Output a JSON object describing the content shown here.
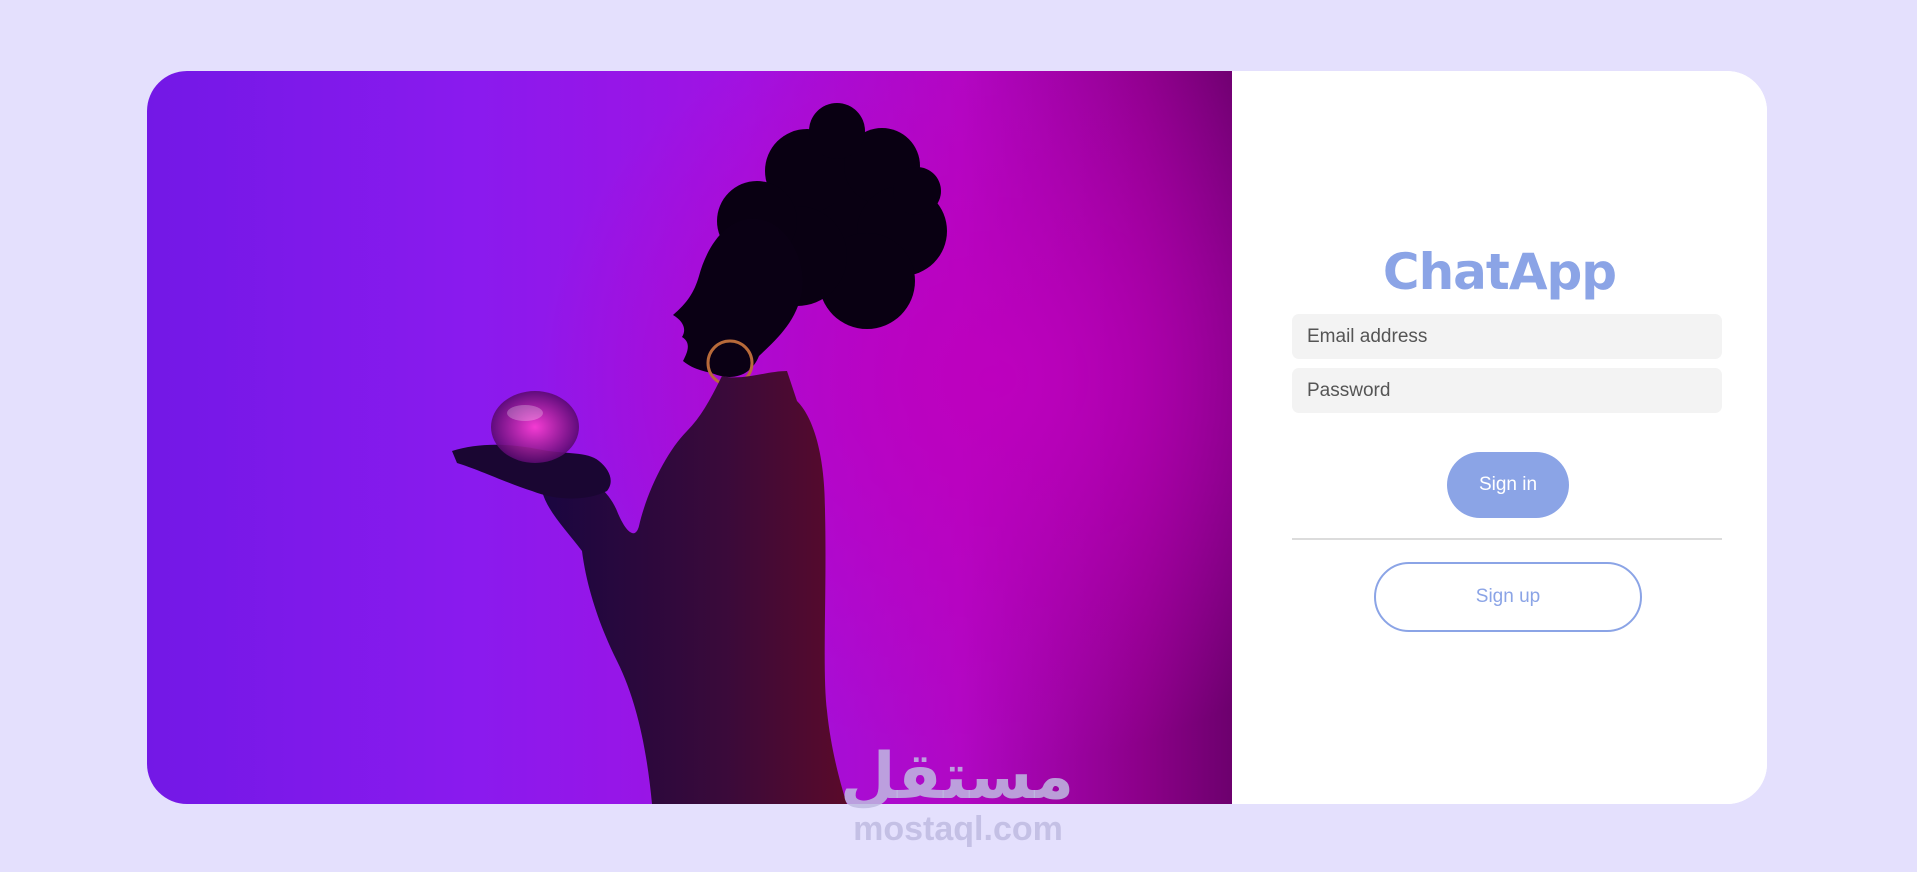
{
  "hero": {
    "image": "woman-holding-glass-sphere-silhouette",
    "colors": {
      "left": "#7318e6",
      "center": "#a112e2",
      "right": "#b107c4",
      "silhouette": "#0a0014"
    }
  },
  "login": {
    "brand": "ChatApp",
    "email_placeholder": "Email address",
    "password_placeholder": "Password",
    "signin_label": "Sign in",
    "signup_label": "Sign up"
  },
  "theme": {
    "background": "#e4e0fd",
    "accent": "#8ba4e6",
    "field_background": "#f3f3f3"
  },
  "watermark": {
    "logo": "مستقل",
    "site": "mostaql.com"
  }
}
